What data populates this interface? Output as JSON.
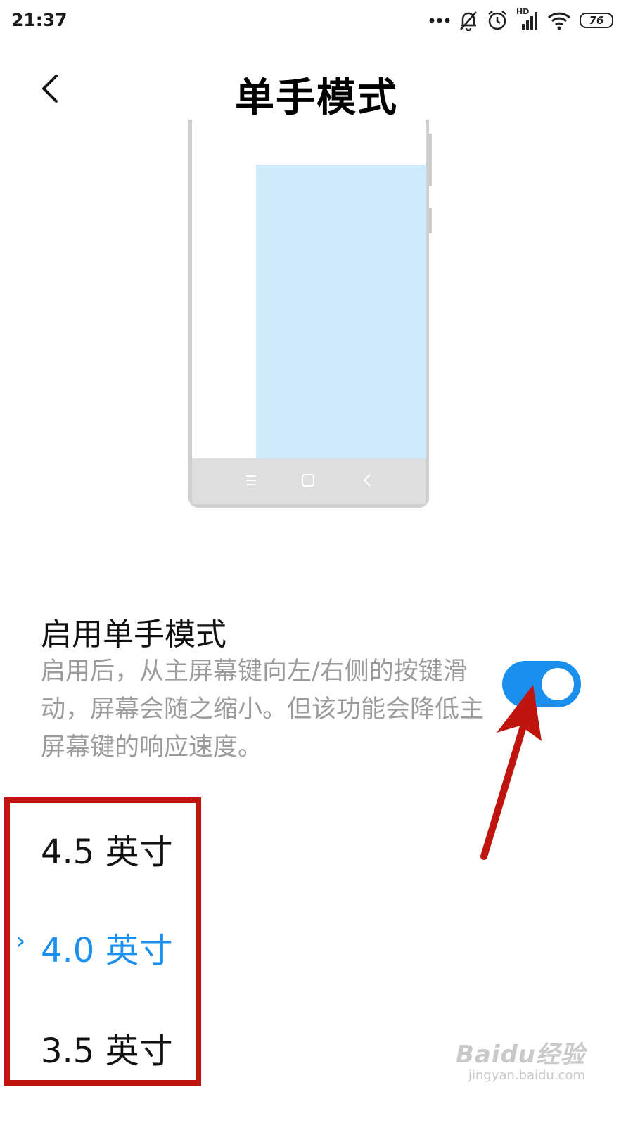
{
  "status_bar": {
    "time": "21:37",
    "battery": "76",
    "network_label": "HD",
    "icons": [
      "more-dots-icon",
      "bell-off-icon",
      "alarm-icon",
      "hd-signal-icon",
      "wifi-icon",
      "battery-icon"
    ]
  },
  "header": {
    "title": "单手模式",
    "back_icon": "chevron-left-icon"
  },
  "illustration": {
    "highlight_color": "#cde9fb",
    "navbar_icons": [
      "menu-icon",
      "home-square-icon",
      "back-chevron-icon"
    ]
  },
  "settings": {
    "enable_title": "启用单手模式",
    "enable_description": "启用后，从主屏幕键向左/右侧的按键滑动，屏幕会随之缩小。但该功能会降低主屏幕键的响应速度。",
    "enabled": true,
    "accent_color": "#1b8fee"
  },
  "size_options": [
    {
      "label": "4.5 英寸",
      "selected": false
    },
    {
      "label": "4.0 英寸",
      "selected": true
    },
    {
      "label": "3.5 英寸",
      "selected": false
    }
  ],
  "selected_marker": "›",
  "annotation_color": "#c0150f",
  "watermark": {
    "brand": "Baidu经验",
    "url": "jingyan.baidu.com"
  }
}
